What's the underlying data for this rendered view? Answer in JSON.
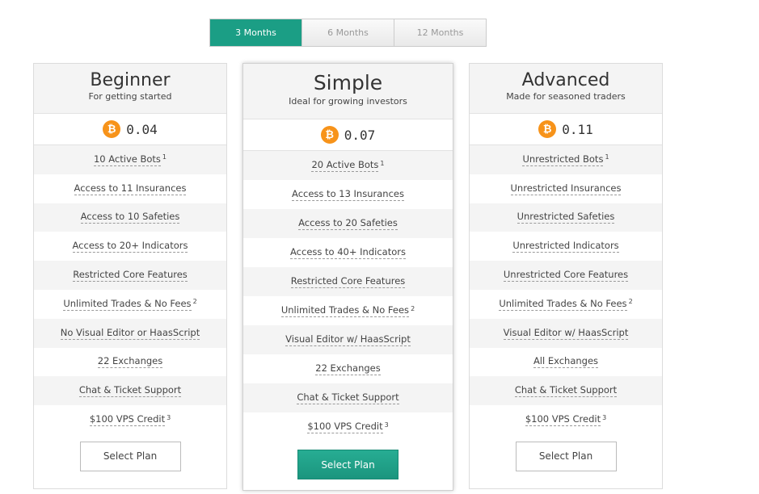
{
  "tabs": [
    "3 Months",
    "6 Months",
    "12 Months"
  ],
  "active_tab": 0,
  "plans": {
    "beginner": {
      "title": "Beginner",
      "tagline": "For getting started",
      "price": "0.04",
      "features": [
        {
          "text": "10 Active Bots",
          "note": "1"
        },
        {
          "text": "Access to 11 Insurances",
          "note": ""
        },
        {
          "text": "Access to 10 Safeties",
          "note": ""
        },
        {
          "text": "Access to 20+ Indicators",
          "note": ""
        },
        {
          "text": "Restricted Core Features",
          "note": ""
        },
        {
          "text": "Unlimited Trades & No Fees",
          "note": "2"
        },
        {
          "text": "No Visual Editor or HaasScript",
          "note": ""
        },
        {
          "text": "22 Exchanges",
          "note": ""
        },
        {
          "text": "Chat & Ticket Support",
          "note": ""
        },
        {
          "text": "$100 VPS Credit",
          "note": "3"
        }
      ],
      "button": "Select Plan"
    },
    "simple": {
      "title": "Simple",
      "tagline": "Ideal for growing investors",
      "price": "0.07",
      "features": [
        {
          "text": "20 Active Bots",
          "note": "1"
        },
        {
          "text": "Access to 13 Insurances",
          "note": ""
        },
        {
          "text": "Access to 20 Safeties",
          "note": ""
        },
        {
          "text": "Access to 40+ Indicators",
          "note": ""
        },
        {
          "text": "Restricted Core Features",
          "note": ""
        },
        {
          "text": "Unlimited Trades & No Fees",
          "note": "2"
        },
        {
          "text": "Visual Editor w/ HaasScript",
          "note": ""
        },
        {
          "text": "22 Exchanges",
          "note": ""
        },
        {
          "text": "Chat & Ticket Support",
          "note": ""
        },
        {
          "text": "$100 VPS Credit",
          "note": "3"
        }
      ],
      "button": "Select Plan"
    },
    "advanced": {
      "title": "Advanced",
      "tagline": "Made for seasoned traders",
      "price": "0.11",
      "features": [
        {
          "text": "Unrestricted Bots",
          "note": "1"
        },
        {
          "text": "Unrestricted Insurances",
          "note": ""
        },
        {
          "text": "Unrestricted Safeties",
          "note": ""
        },
        {
          "text": "Unrestricted Indicators",
          "note": ""
        },
        {
          "text": "Unrestricted Core Features",
          "note": ""
        },
        {
          "text": "Unlimited Trades & No Fees",
          "note": "2"
        },
        {
          "text": "Visual Editor w/ HaasScript",
          "note": ""
        },
        {
          "text": "All Exchanges",
          "note": ""
        },
        {
          "text": "Chat & Ticket Support",
          "note": ""
        },
        {
          "text": "$100 VPS Credit",
          "note": "3"
        }
      ],
      "button": "Select Plan"
    }
  },
  "coin_icon": "bitcoin-icon",
  "colors": {
    "accent": "#1b9e85",
    "coin": "#f7931a"
  }
}
